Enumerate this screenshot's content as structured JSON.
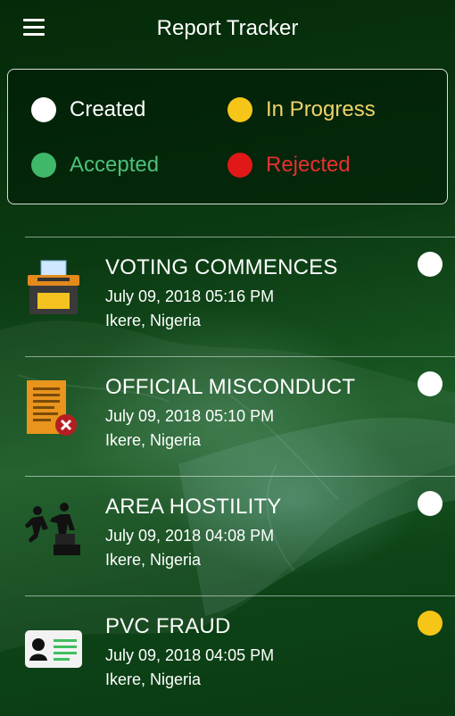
{
  "app": {
    "title": "Report Tracker"
  },
  "legend": [
    {
      "label": "Created",
      "color": "#ffffff",
      "text_color": "#ffffff"
    },
    {
      "label": "In Progress",
      "color": "#f5c518",
      "text_color": "#f0d36a"
    },
    {
      "label": "Accepted",
      "color": "#3fb86a",
      "text_color": "#4cc07a"
    },
    {
      "label": "Rejected",
      "color": "#e01818",
      "text_color": "#e83030"
    }
  ],
  "reports": [
    {
      "title": "VOTING COMMENCES",
      "date": "July 09, 2018 05:16 PM",
      "location": "Ikere, Nigeria",
      "status": "Created",
      "status_color": "#ffffff",
      "icon": "ballot-box-icon"
    },
    {
      "title": "OFFICIAL MISCONDUCT",
      "date": "July 09, 2018 05:10 PM",
      "location": "Ikere, Nigeria",
      "status": "Created",
      "status_color": "#ffffff",
      "icon": "rejected-document-icon"
    },
    {
      "title": "AREA HOSTILITY",
      "date": "July 09, 2018 04:08 PM",
      "location": "Ikere, Nigeria",
      "status": "Created",
      "status_color": "#ffffff",
      "icon": "fighting-people-icon"
    },
    {
      "title": "PVC FRAUD",
      "date": "July 09, 2018 04:05 PM",
      "location": "Ikere, Nigeria",
      "status": "In Progress",
      "status_color": "#f5c518",
      "icon": "voter-card-icon"
    }
  ]
}
